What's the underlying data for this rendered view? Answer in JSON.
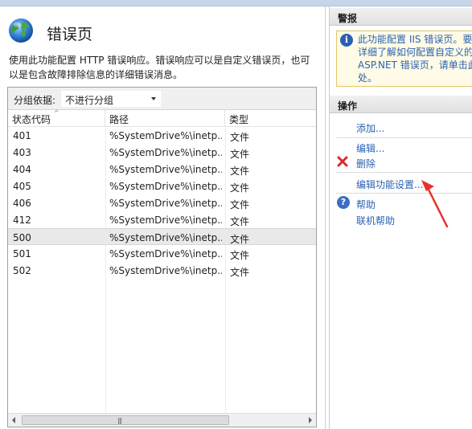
{
  "page": {
    "title": "错误页",
    "description_line1": "使用此功能配置 HTTP 错误响应。错误响应可以是自定义错误页，也可",
    "description_line2": "以是包含故障排除信息的详细错误消息。"
  },
  "grouping": {
    "label": "分组依据:",
    "selected": "不进行分组"
  },
  "table": {
    "columns": [
      "状态代码",
      "路径",
      "类型"
    ],
    "rows": [
      {
        "code": "401",
        "path": "%SystemDrive%\\inetp...",
        "type": "文件"
      },
      {
        "code": "403",
        "path": "%SystemDrive%\\inetp...",
        "type": "文件"
      },
      {
        "code": "404",
        "path": "%SystemDrive%\\inetp...",
        "type": "文件"
      },
      {
        "code": "405",
        "path": "%SystemDrive%\\inetp...",
        "type": "文件"
      },
      {
        "code": "406",
        "path": "%SystemDrive%\\inetp...",
        "type": "文件"
      },
      {
        "code": "412",
        "path": "%SystemDrive%\\inetp...",
        "type": "文件"
      },
      {
        "code": "500",
        "path": "%SystemDrive%\\inetp...",
        "type": "文件"
      },
      {
        "code": "501",
        "path": "%SystemDrive%\\inetp...",
        "type": "文件"
      },
      {
        "code": "502",
        "path": "%SystemDrive%\\inetp...",
        "type": "文件"
      }
    ],
    "selected_row": "500"
  },
  "alerts": {
    "header": "警报",
    "lines": [
      "此功能配置 IIS 错误页。要",
      "详细了解如何配置自定义的",
      "ASP.NET 错误页，请单击此",
      "处。"
    ]
  },
  "actions": {
    "header": "操作",
    "add": "添加...",
    "edit": "编辑...",
    "delete": "删除",
    "edit_feature_settings": "编辑功能设置...",
    "help": "帮助",
    "online_help": "联机帮助"
  },
  "icons": {
    "page": "globe-icon",
    "alert": "info-icon",
    "delete": "red-x-icon",
    "help": "help-icon",
    "scroll_grip": "|||"
  },
  "colors": {
    "link": "#2b62b2",
    "alert_bg": "#fffbe6",
    "alert_border": "#e3c766",
    "annotation_arrow": "#e8312e"
  }
}
